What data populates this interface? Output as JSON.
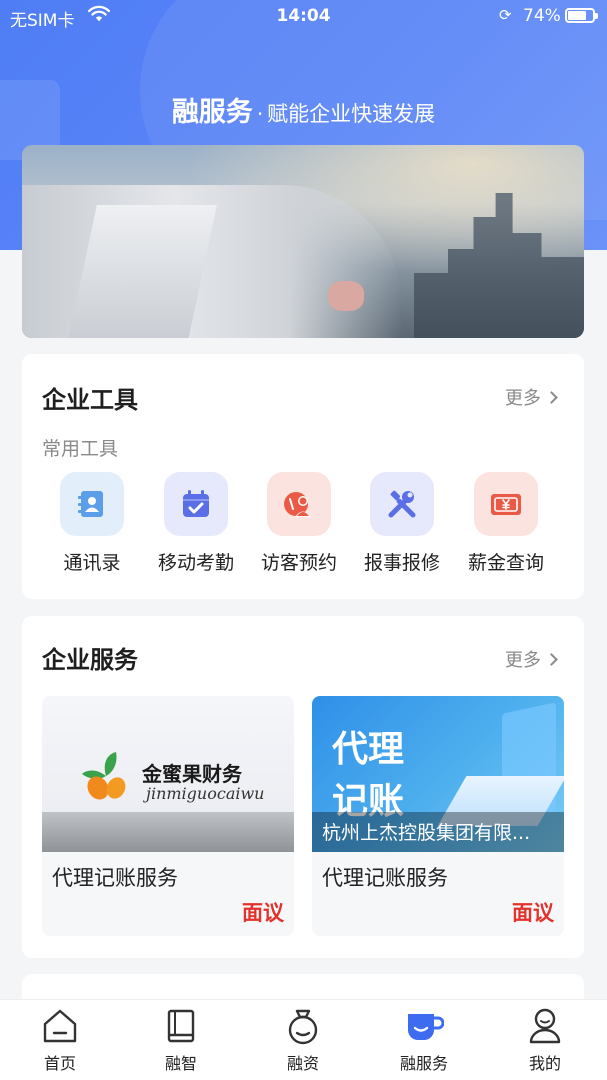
{
  "status_bar": {
    "carrier": "无SIM卡",
    "time": "14:04",
    "battery": "74%",
    "battery_level": 0.74
  },
  "header": {
    "title": "融服务",
    "separator": "·",
    "subtitle": "赋能企业快速发展"
  },
  "tools": {
    "title": "企业工具",
    "more": "更多",
    "subtitle": "常用工具",
    "items": [
      {
        "label": "通讯录",
        "icon": "contacts-icon",
        "bg": "#e3eefb",
        "fg": "#5b9ee9"
      },
      {
        "label": "移动考勤",
        "icon": "calendar-check-icon",
        "bg": "#e6e9fb",
        "fg": "#5a6ee6"
      },
      {
        "label": "访客预约",
        "icon": "visitor-icon",
        "bg": "#fbe4e0",
        "fg": "#ea5a46"
      },
      {
        "label": "报事报修",
        "icon": "repair-tools-icon",
        "bg": "#e6e9fb",
        "fg": "#5a6ee6"
      },
      {
        "label": "薪金查询",
        "icon": "salary-icon",
        "bg": "#fbe4e0",
        "fg": "#ea5a46"
      }
    ]
  },
  "services": {
    "title": "企业服务",
    "more": "更多",
    "items": [
      {
        "name": "代理记账服务",
        "price": "面议",
        "brand": "金蜜果财务",
        "brand_en": "jinmiguocaiwu"
      },
      {
        "name": "代理记账服务",
        "price": "面议",
        "headline_1": "代理",
        "headline_2": "记账",
        "caption": "杭州上杰控股集团有限..."
      }
    ]
  },
  "tabbar": {
    "items": [
      {
        "label": "首页",
        "icon": "home-icon"
      },
      {
        "label": "融智",
        "icon": "book-icon"
      },
      {
        "label": "融资",
        "icon": "money-bag-icon"
      },
      {
        "label": "融服务",
        "icon": "cup-icon",
        "active": true
      },
      {
        "label": "我的",
        "icon": "user-icon"
      }
    ]
  },
  "colors": {
    "primary": "#4f7df5",
    "price_red": "#e3322c",
    "active_tab": "#3d6cf0"
  }
}
